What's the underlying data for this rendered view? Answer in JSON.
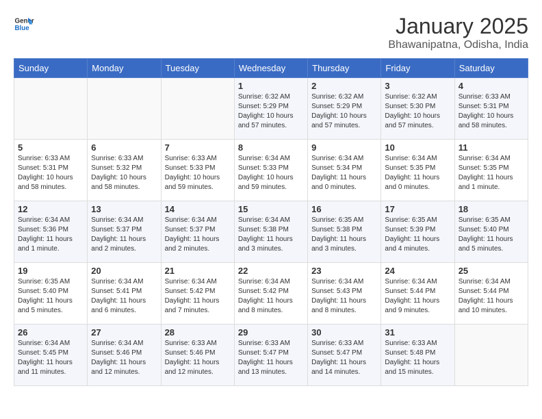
{
  "logo": {
    "line1": "General",
    "line2": "Blue"
  },
  "title": "January 2025",
  "location": "Bhawanipatna, Odisha, India",
  "days_of_week": [
    "Sunday",
    "Monday",
    "Tuesday",
    "Wednesday",
    "Thursday",
    "Friday",
    "Saturday"
  ],
  "weeks": [
    [
      {
        "day": "",
        "content": ""
      },
      {
        "day": "",
        "content": ""
      },
      {
        "day": "",
        "content": ""
      },
      {
        "day": "1",
        "content": "Sunrise: 6:32 AM\nSunset: 5:29 PM\nDaylight: 10 hours\nand 57 minutes."
      },
      {
        "day": "2",
        "content": "Sunrise: 6:32 AM\nSunset: 5:29 PM\nDaylight: 10 hours\nand 57 minutes."
      },
      {
        "day": "3",
        "content": "Sunrise: 6:32 AM\nSunset: 5:30 PM\nDaylight: 10 hours\nand 57 minutes."
      },
      {
        "day": "4",
        "content": "Sunrise: 6:33 AM\nSunset: 5:31 PM\nDaylight: 10 hours\nand 58 minutes."
      }
    ],
    [
      {
        "day": "5",
        "content": "Sunrise: 6:33 AM\nSunset: 5:31 PM\nDaylight: 10 hours\nand 58 minutes."
      },
      {
        "day": "6",
        "content": "Sunrise: 6:33 AM\nSunset: 5:32 PM\nDaylight: 10 hours\nand 58 minutes."
      },
      {
        "day": "7",
        "content": "Sunrise: 6:33 AM\nSunset: 5:33 PM\nDaylight: 10 hours\nand 59 minutes."
      },
      {
        "day": "8",
        "content": "Sunrise: 6:34 AM\nSunset: 5:33 PM\nDaylight: 10 hours\nand 59 minutes."
      },
      {
        "day": "9",
        "content": "Sunrise: 6:34 AM\nSunset: 5:34 PM\nDaylight: 11 hours\nand 0 minutes."
      },
      {
        "day": "10",
        "content": "Sunrise: 6:34 AM\nSunset: 5:35 PM\nDaylight: 11 hours\nand 0 minutes."
      },
      {
        "day": "11",
        "content": "Sunrise: 6:34 AM\nSunset: 5:35 PM\nDaylight: 11 hours\nand 1 minute."
      }
    ],
    [
      {
        "day": "12",
        "content": "Sunrise: 6:34 AM\nSunset: 5:36 PM\nDaylight: 11 hours\nand 1 minute."
      },
      {
        "day": "13",
        "content": "Sunrise: 6:34 AM\nSunset: 5:37 PM\nDaylight: 11 hours\nand 2 minutes."
      },
      {
        "day": "14",
        "content": "Sunrise: 6:34 AM\nSunset: 5:37 PM\nDaylight: 11 hours\nand 2 minutes."
      },
      {
        "day": "15",
        "content": "Sunrise: 6:34 AM\nSunset: 5:38 PM\nDaylight: 11 hours\nand 3 minutes."
      },
      {
        "day": "16",
        "content": "Sunrise: 6:35 AM\nSunset: 5:38 PM\nDaylight: 11 hours\nand 3 minutes."
      },
      {
        "day": "17",
        "content": "Sunrise: 6:35 AM\nSunset: 5:39 PM\nDaylight: 11 hours\nand 4 minutes."
      },
      {
        "day": "18",
        "content": "Sunrise: 6:35 AM\nSunset: 5:40 PM\nDaylight: 11 hours\nand 5 minutes."
      }
    ],
    [
      {
        "day": "19",
        "content": "Sunrise: 6:35 AM\nSunset: 5:40 PM\nDaylight: 11 hours\nand 5 minutes."
      },
      {
        "day": "20",
        "content": "Sunrise: 6:34 AM\nSunset: 5:41 PM\nDaylight: 11 hours\nand 6 minutes."
      },
      {
        "day": "21",
        "content": "Sunrise: 6:34 AM\nSunset: 5:42 PM\nDaylight: 11 hours\nand 7 minutes."
      },
      {
        "day": "22",
        "content": "Sunrise: 6:34 AM\nSunset: 5:42 PM\nDaylight: 11 hours\nand 8 minutes."
      },
      {
        "day": "23",
        "content": "Sunrise: 6:34 AM\nSunset: 5:43 PM\nDaylight: 11 hours\nand 8 minutes."
      },
      {
        "day": "24",
        "content": "Sunrise: 6:34 AM\nSunset: 5:44 PM\nDaylight: 11 hours\nand 9 minutes."
      },
      {
        "day": "25",
        "content": "Sunrise: 6:34 AM\nSunset: 5:44 PM\nDaylight: 11 hours\nand 10 minutes."
      }
    ],
    [
      {
        "day": "26",
        "content": "Sunrise: 6:34 AM\nSunset: 5:45 PM\nDaylight: 11 hours\nand 11 minutes."
      },
      {
        "day": "27",
        "content": "Sunrise: 6:34 AM\nSunset: 5:46 PM\nDaylight: 11 hours\nand 12 minutes."
      },
      {
        "day": "28",
        "content": "Sunrise: 6:33 AM\nSunset: 5:46 PM\nDaylight: 11 hours\nand 12 minutes."
      },
      {
        "day": "29",
        "content": "Sunrise: 6:33 AM\nSunset: 5:47 PM\nDaylight: 11 hours\nand 13 minutes."
      },
      {
        "day": "30",
        "content": "Sunrise: 6:33 AM\nSunset: 5:47 PM\nDaylight: 11 hours\nand 14 minutes."
      },
      {
        "day": "31",
        "content": "Sunrise: 6:33 AM\nSunset: 5:48 PM\nDaylight: 11 hours\nand 15 minutes."
      },
      {
        "day": "",
        "content": ""
      }
    ]
  ]
}
